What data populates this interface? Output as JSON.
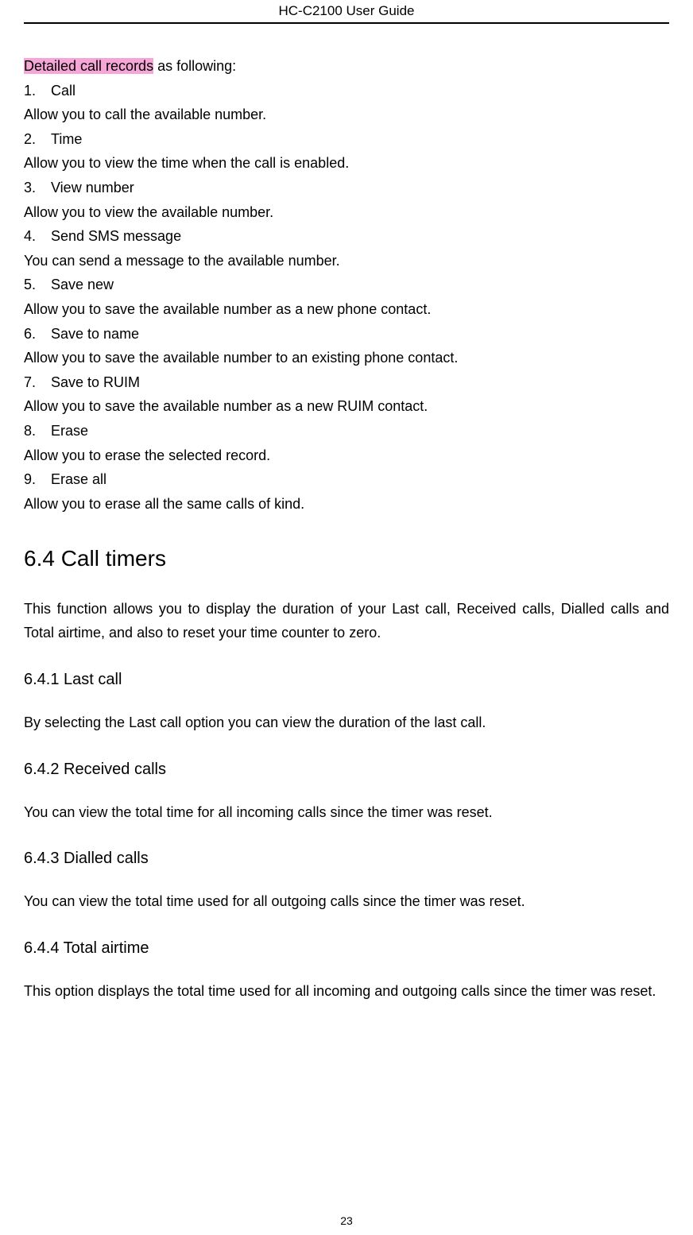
{
  "header": {
    "title": "HC-C2100 User Guide"
  },
  "intro": {
    "highlighted": "Detailed call records",
    "rest": " as following:"
  },
  "items": [
    {
      "num": "1.",
      "title": "Call",
      "desc": "Allow you to call the available number."
    },
    {
      "num": "2.",
      "title": "Time",
      "desc": "Allow you to view the time when the call is enabled."
    },
    {
      "num": "3.",
      "title": "View number",
      "desc": "Allow you to view the available number."
    },
    {
      "num": "4.",
      "title": "Send SMS message",
      "desc": "You can send a message to the available number."
    },
    {
      "num": "5.",
      "title": "Save new",
      "desc": "Allow you to save the available number as a new phone contact."
    },
    {
      "num": "6.",
      "title": "Save to name",
      "desc": "Allow you to save the available number to an existing phone contact."
    },
    {
      "num": "7.",
      "title": "Save to RUIM",
      "desc": "Allow you to save the available number as a new RUIM contact."
    },
    {
      "num": "8.",
      "title": "Erase",
      "desc": "Allow you to erase the selected record."
    },
    {
      "num": "9.",
      "title": "Erase all",
      "desc": "Allow you to erase all the same calls of kind."
    }
  ],
  "sections": {
    "main": {
      "title": "6.4 Call timers",
      "para": "This function allows you to display the duration of your Last call, Received calls, Dialled calls and Total airtime, and also to reset your time counter to zero."
    },
    "s1": {
      "title": "6.4.1 Last call",
      "para": "By selecting the Last call option you can view the duration of the last call."
    },
    "s2": {
      "title": "6.4.2 Received calls",
      "para": "You can view the total time for all incoming calls since the timer was reset."
    },
    "s3": {
      "title": "6.4.3 Dialled calls",
      "para": "You can view the total time used for all outgoing calls since the timer was reset."
    },
    "s4": {
      "title": "6.4.4 Total airtime",
      "para": "This option displays the total time used for all incoming and outgoing calls since the timer was reset."
    }
  },
  "pageNumber": "23"
}
